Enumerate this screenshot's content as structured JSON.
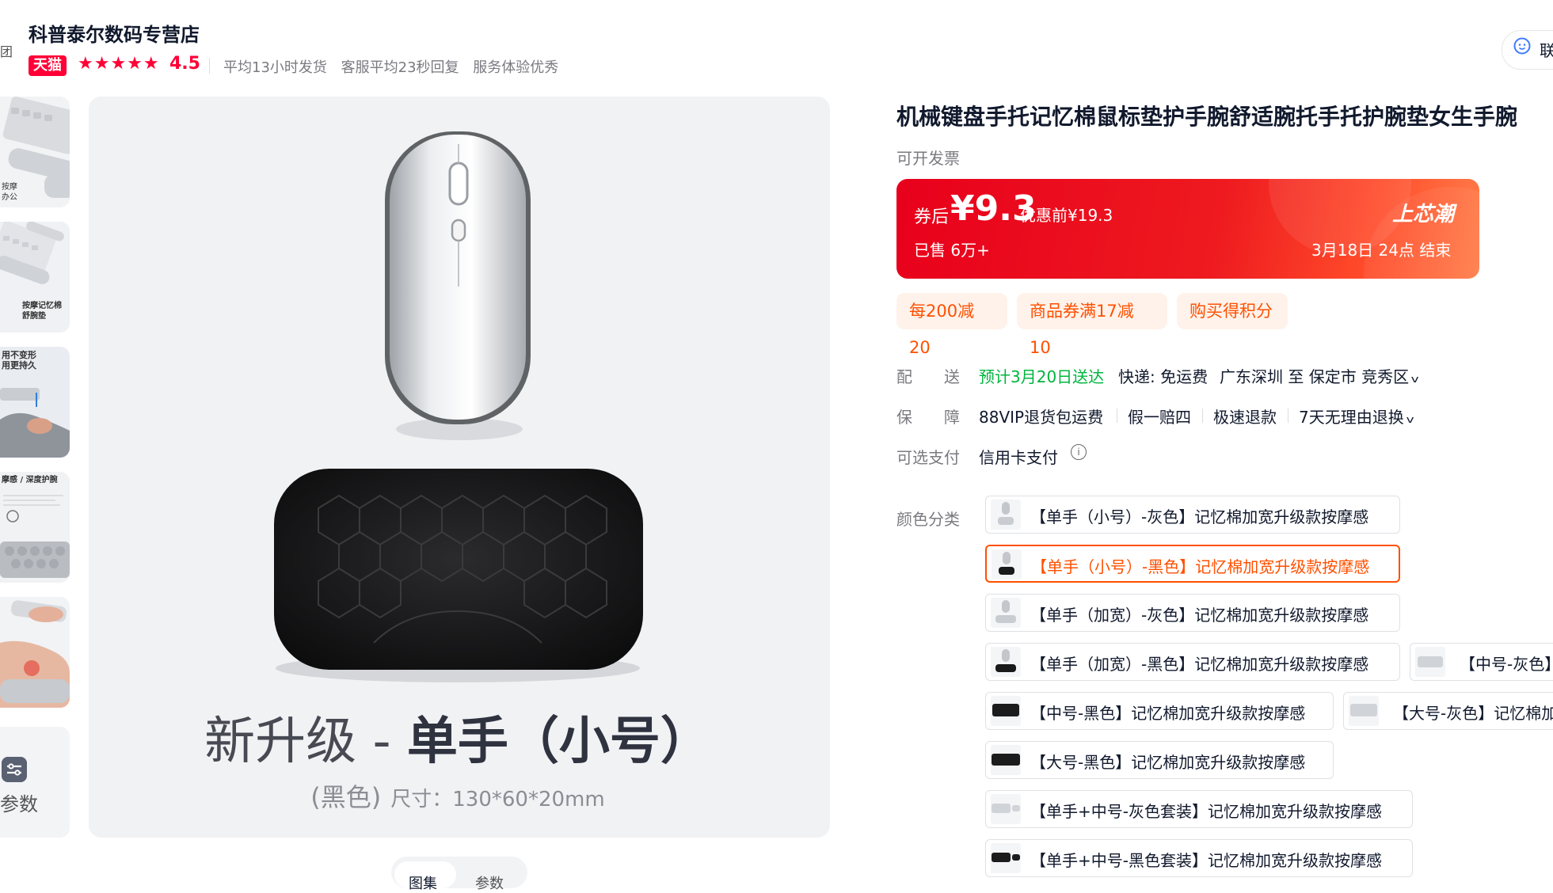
{
  "store": {
    "name": "科普泰尔数码专营店",
    "badge": "天猫",
    "stars": "★★★★★",
    "rating": "4.5",
    "services": [
      "平均13小时发货",
      "客服平均23秒回复",
      "服务体验优秀"
    ],
    "contact_label": "联",
    "left_edge": "团"
  },
  "thumbnails": [
    {
      "caption": "按摩\n办公"
    },
    {
      "caption": "按摩记忆棉\n舒腕垫"
    },
    {
      "caption": "用不变形\n用更持久"
    },
    {
      "caption": "摩感 / 深度护腕"
    },
    {
      "caption": ""
    }
  ],
  "params_label": "参数",
  "main_image": {
    "headline_prefix": "新升级 - ",
    "headline_main": "单手（小号）",
    "sub_color": "(黑色)",
    "sub_size": "尺寸：130*60*20mm"
  },
  "view_tabs": [
    "图集",
    "参数"
  ],
  "product": {
    "title": "机械键盘手托记忆棉鼠标垫护手腕舒适腕托手托护腕垫女生手腕",
    "invoice": "可开发票"
  },
  "price": {
    "after_label": "券后",
    "after_value": "¥9.3",
    "before": "优惠前¥19.3",
    "sold": "已售 6万+",
    "brand_tag": "上芯潮",
    "end_time": "3月18日 24点  结束"
  },
  "promos": [
    "每200减20",
    "商品券满17减10",
    "购买得积分"
  ],
  "delivery": {
    "label": "配　　送",
    "eta": "预计3月20日送达",
    "express": "快递: 免运费",
    "route": "广东深圳  至  保定市 竞秀区"
  },
  "guarantee": {
    "label": "保　　障",
    "items": [
      "88VIP退货包运费",
      "假一赔四",
      "极速退款",
      "7天无理由退换"
    ]
  },
  "payment": {
    "label": "可选支付",
    "value": "信用卡支付",
    "info_glyph": "i"
  },
  "sku": {
    "label": "颜色分类",
    "options": [
      "【单手（小号）-灰色】记忆棉加宽升级款按摩感",
      "【单手（小号）-黑色】记忆棉加宽升级款按摩感",
      "【单手（加宽）-灰色】记忆棉加宽升级款按摩感",
      "【单手（加宽）-黑色】记忆棉加宽升级款按摩感",
      "【中号-灰色】",
      "【中号-黑色】记忆棉加宽升级款按摩感",
      "【大号-灰色】记忆棉加",
      "【大号-黑色】记忆棉加宽升级款按摩感",
      "【单手+中号-灰色套装】记忆棉加宽升级款按摩感",
      "【单手+中号-黑色套装】记忆棉加宽升级款按摩感"
    ],
    "selected_index": 1
  },
  "colors": {
    "accent": "#ff5000",
    "tmall_red": "#ff0036",
    "banner_red": "#ee1a1f",
    "delivery_green": "#00b53f"
  }
}
